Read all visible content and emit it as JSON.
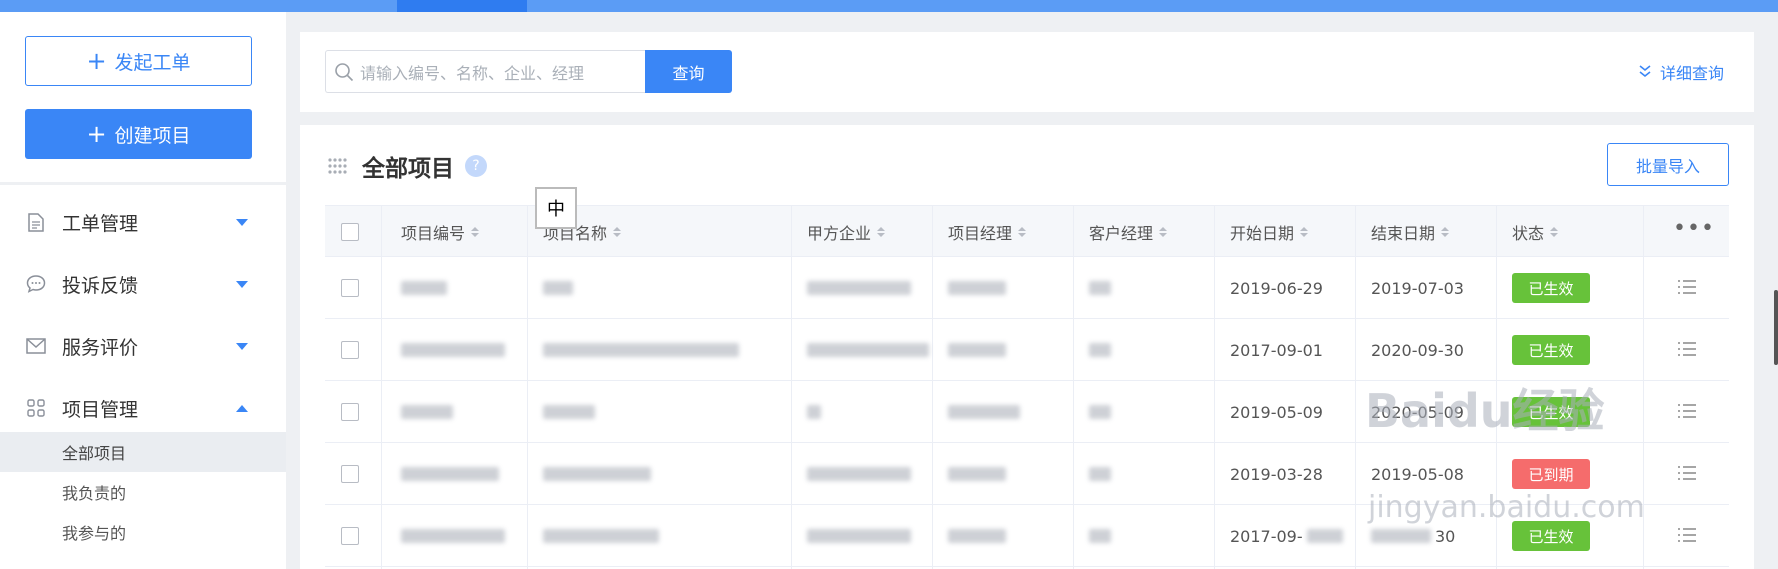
{
  "sidebar": {
    "create_ticket": "发起工单",
    "create_project": "创建项目",
    "nav": [
      {
        "label": "工单管理",
        "icon": "document-icon",
        "expanded": false
      },
      {
        "label": "投诉反馈",
        "icon": "chat-icon",
        "expanded": false
      },
      {
        "label": "服务评价",
        "icon": "mail-icon",
        "expanded": false
      },
      {
        "label": "项目管理",
        "icon": "apps-icon",
        "expanded": true
      }
    ],
    "sub_items": [
      "全部项目",
      "我负责的",
      "我参与的"
    ]
  },
  "search": {
    "placeholder": "请输入编号、名称、企业、经理",
    "button": "查询",
    "detail": "详细查询"
  },
  "main": {
    "title": "全部项目",
    "help": "?",
    "import_button": "批量导入",
    "ime_char": "中"
  },
  "table": {
    "columns": [
      "项目编号",
      "项目名称",
      "甲方企业",
      "项目经理",
      "客户经理",
      "开始日期",
      "结束日期",
      "状态"
    ],
    "more": "•••",
    "rows": [
      {
        "start": "2019-06-29",
        "end": "2019-07-03",
        "status": "已生效",
        "status_color": "#67c23a"
      },
      {
        "start": "2017-09-01",
        "end": "2020-09-30",
        "status": "已生效",
        "status_color": "#67c23a"
      },
      {
        "start": "2019-05-09",
        "end": "2020-05-09",
        "status": "已生效",
        "status_color": "#67c23a"
      },
      {
        "start": "2019-03-28",
        "end": "2019-05-08",
        "status": "已到期",
        "status_color": "#f56c6c"
      },
      {
        "start": "2017-09-",
        "end": "30",
        "status": "已生效",
        "status_color": "#67c23a"
      }
    ]
  },
  "watermark": {
    "brand": "Baidu经验",
    "url": "jingyan.baidu.com"
  },
  "colors": {
    "primary": "#3a86f6",
    "success": "#67c23a",
    "danger": "#f56c6c"
  }
}
